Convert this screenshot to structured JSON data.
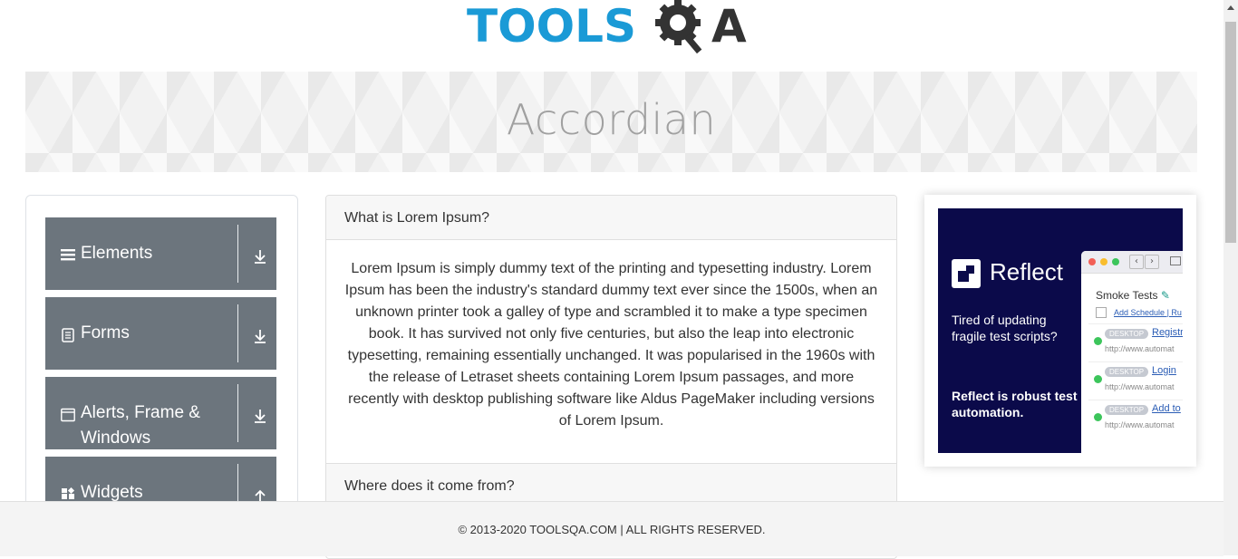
{
  "logo": {
    "text_part": "TOOLS",
    "text_q": "Q",
    "text_a": "A"
  },
  "banner": {
    "title": "Accordian"
  },
  "nav": {
    "groups": [
      {
        "label": "Elements",
        "icon": "hamburger-icon",
        "arrow": "download-arrow-icon"
      },
      {
        "label": "Forms",
        "icon": "document-icon",
        "arrow": "download-arrow-icon"
      },
      {
        "label": "Alerts, Frame & Windows",
        "icon": "window-icon",
        "arrow": "download-arrow-icon"
      },
      {
        "label": "Widgets",
        "icon": "widgets-icon",
        "arrow": "up-arrow-icon"
      }
    ]
  },
  "accordion": {
    "sections": [
      {
        "header": "What is Lorem Ipsum?",
        "body": "Lorem Ipsum is simply dummy text of the printing and typesetting industry. Lorem Ipsum has been the industry's standard dummy text ever since the 1500s, when an unknown printer took a galley of type and scrambled it to make a type specimen book. It has survived not only five centuries, but also the leap into electronic typesetting, remaining essentially unchanged. It was popularised in the 1960s with the release of Letraset sheets containing Lorem Ipsum passages, and more recently with desktop publishing software like Aldus PageMaker including versions of Lorem Ipsum."
      },
      {
        "header": "Where does it come from?"
      }
    ]
  },
  "ad": {
    "brand": "Reflect",
    "tagline": "Tired of updating fragile test scripts?",
    "pitch": "Reflect is robust test automation.",
    "window": {
      "title": "Smoke Tests",
      "schedule": "Add Schedule",
      "schedule_extra": "| Ru",
      "rows": [
        {
          "tag": "DESKTOP",
          "name": "Registr",
          "url": "http://www.automat"
        },
        {
          "tag": "DESKTOP",
          "name": "Login",
          "url": "http://www.automat"
        },
        {
          "tag": "DESKTOP",
          "name": "Add to",
          "url": "http://www.automat"
        }
      ]
    }
  },
  "footer": {
    "text": "© 2013-2020 TOOLSQA.COM | ALL RIGHTS RESERVED."
  },
  "colors": {
    "logo_blue": "#1a9ad6",
    "logo_dark": "#333333",
    "nav_group": "#6c757d",
    "ad_bg": "#0b0a4a"
  }
}
